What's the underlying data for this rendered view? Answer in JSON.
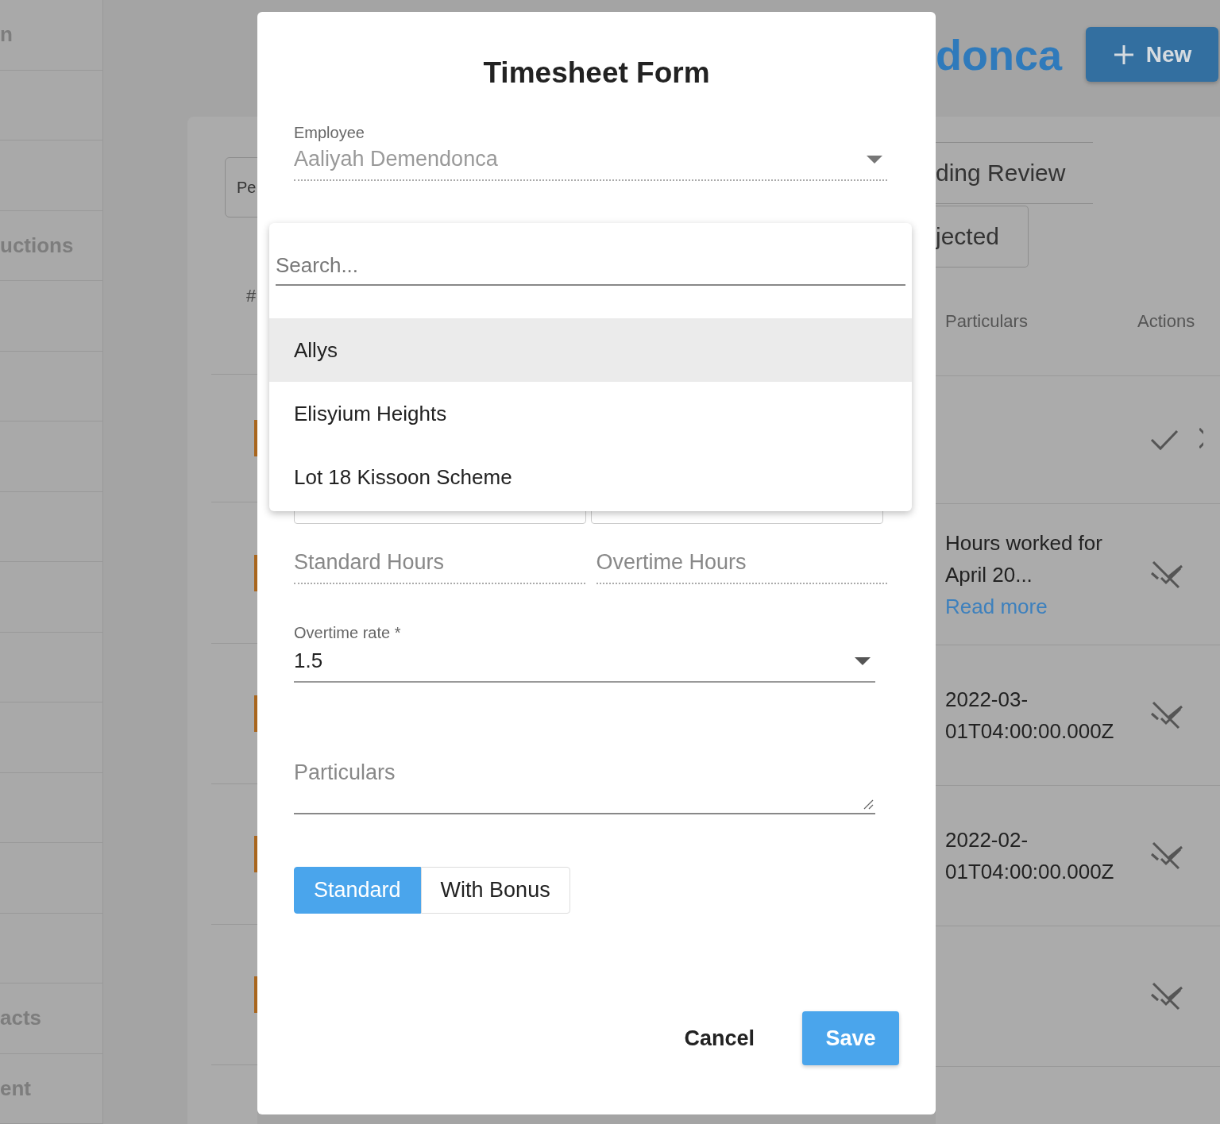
{
  "sidebar": {
    "items": [
      {
        "kind": "label",
        "label": "n"
      },
      {
        "kind": "blank"
      },
      {
        "kind": "blank"
      },
      {
        "kind": "label",
        "label": "uctions"
      },
      {
        "kind": "blank"
      },
      {
        "kind": "blank"
      },
      {
        "kind": "blank"
      },
      {
        "kind": "blank"
      },
      {
        "kind": "blank"
      },
      {
        "kind": "blank"
      },
      {
        "kind": "blank"
      },
      {
        "kind": "blank"
      },
      {
        "kind": "blank"
      },
      {
        "kind": "blank"
      },
      {
        "kind": "label",
        "label": "acts"
      },
      {
        "kind": "label",
        "label": "ent"
      }
    ]
  },
  "header": {
    "title": "donca",
    "new_button": "New"
  },
  "status_tabs": {
    "left": "Pe",
    "right": [
      {
        "label": "ding Review",
        "kind": "line"
      },
      {
        "label": "jected",
        "kind": "box"
      }
    ]
  },
  "table": {
    "columns": [
      {
        "label": "#"
      },
      {
        "label": "Particulars"
      },
      {
        "label": "Actions"
      }
    ],
    "rows": [
      {
        "kind": "approve"
      },
      {
        "particulars": "Hours worked for April 20...",
        "link": "Read more",
        "kind": "blocked"
      },
      {
        "particulars": "2022-03-01T04:00:00.000Z",
        "kind": "blocked"
      },
      {
        "particulars": "2022-02-01T04:00:00.000Z",
        "kind": "blocked"
      },
      {
        "kind": "blocked"
      }
    ]
  },
  "modal": {
    "title": "Timesheet Form",
    "employee": {
      "label": "Employee",
      "value": "Aaliyah Demendonca",
      "disabled": true
    },
    "location_dropdown": {
      "search_placeholder": "Search...",
      "options": [
        {
          "label": "Allys",
          "selected": true
        },
        {
          "label": "Elisyium Heights",
          "selected": false
        },
        {
          "label": "Lot 18 Kissoon Scheme",
          "selected": false
        }
      ]
    },
    "hours": [
      {
        "placeholder": "Standard Hours",
        "disabled": true
      },
      {
        "placeholder": "Overtime Hours",
        "disabled": true
      }
    ],
    "overtime_rate": {
      "label": "Overtime rate *",
      "value": "1.5"
    },
    "particulars": {
      "placeholder": "Particulars"
    },
    "pay_type": [
      {
        "label": "Standard",
        "selected": true
      },
      {
        "label": "With Bonus",
        "selected": false
      }
    ],
    "buttons": [
      {
        "label": "Cancel",
        "kind": "text"
      },
      {
        "label": "Save",
        "kind": "primary"
      }
    ]
  }
}
